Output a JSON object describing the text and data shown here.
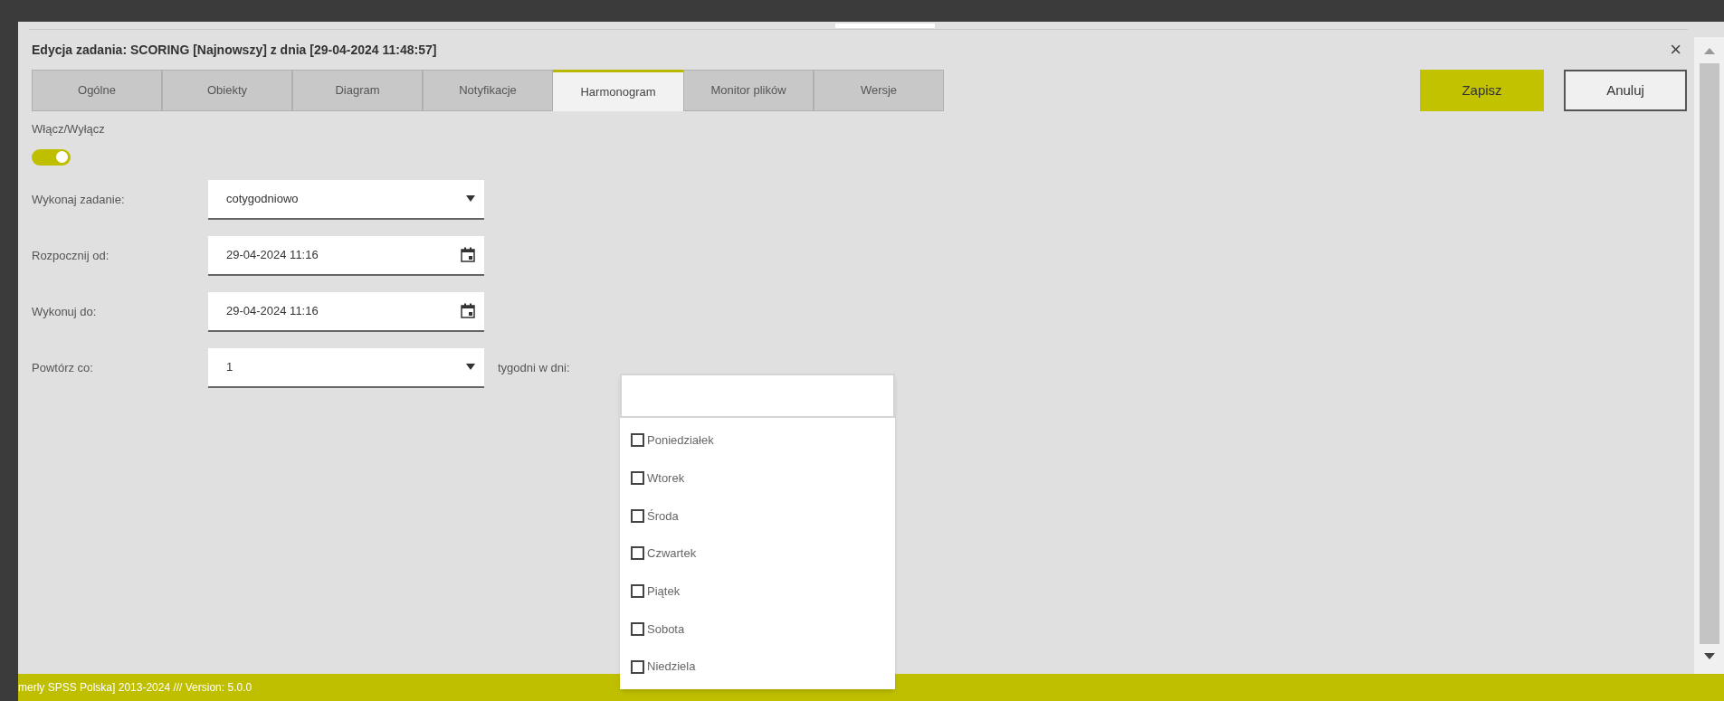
{
  "dialog": {
    "title": "Edycja zadania: SCORING [Najnowszy] z dnia [29-04-2024 11:48:57]",
    "close": "×"
  },
  "tabs": [
    {
      "label": "Ogólne",
      "selected": false
    },
    {
      "label": "Obiekty",
      "selected": false
    },
    {
      "label": "Diagram",
      "selected": false
    },
    {
      "label": "Notyfikacje",
      "selected": false
    },
    {
      "label": "Harmonogram",
      "selected": true
    },
    {
      "label": "Monitor plików",
      "selected": false
    },
    {
      "label": "Wersje",
      "selected": false
    }
  ],
  "buttons": {
    "save": "Zapisz",
    "cancel": "Anuluj"
  },
  "toggle": {
    "label": "Włącz/Wyłącz",
    "on": true
  },
  "fields": [
    {
      "kind": "select",
      "label": "Wykonaj zadanie:",
      "value": "cotygodniowo"
    },
    {
      "kind": "date",
      "label": "Rozpocznij od:",
      "value": "29-04-2024 11:16"
    },
    {
      "kind": "date",
      "label": "Wykonuj do:",
      "value": "29-04-2024 11:16"
    },
    {
      "kind": "select",
      "label": "Powtórz co:",
      "value": "1"
    }
  ],
  "days_label": "tygodni w dni:",
  "days": [
    {
      "label": "Poniedziałek",
      "checked": false
    },
    {
      "label": "Wtorek",
      "checked": false
    },
    {
      "label": "Środa",
      "checked": false
    },
    {
      "label": "Czwartek",
      "checked": false
    },
    {
      "label": "Piątek",
      "checked": false
    },
    {
      "label": "Sobota",
      "checked": false
    },
    {
      "label": "Niedziela",
      "checked": false
    }
  ],
  "footer": "merly SPSS Polska] 2013-2024 /// Version: 5.0.0"
}
